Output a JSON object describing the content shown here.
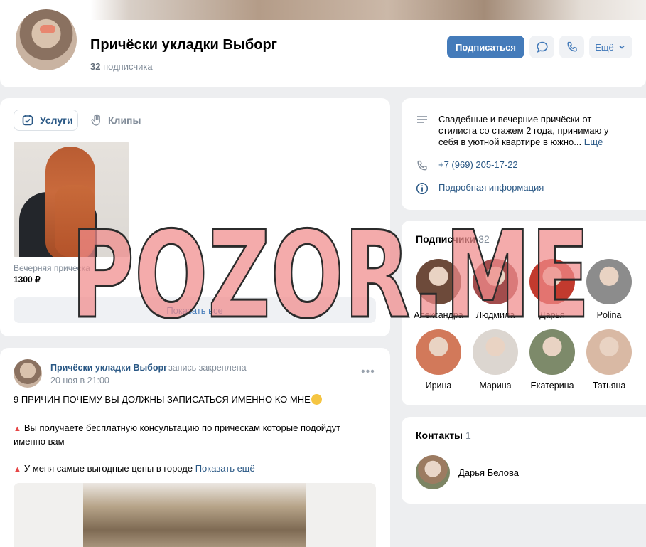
{
  "header": {
    "group_name": "Причёски укладки Выборг",
    "subscribers_count": "32",
    "subscribers_label": "подписчика",
    "subscribe_label": "Подписаться",
    "more_label": "Ещё",
    "icons": [
      "message-icon",
      "phone-icon",
      "chevron-down-icon"
    ]
  },
  "services": {
    "tabs": [
      {
        "label": "Услуги",
        "icon": "calendar-check-icon",
        "active": true
      },
      {
        "label": "Клипы",
        "icon": "clips-icon",
        "active": false
      }
    ],
    "items": [
      {
        "name": "Вечерняя прическа",
        "price": "1300 ₽"
      }
    ],
    "show_all_label": "Показать все"
  },
  "post": {
    "author": "Причёски укладки Выборг",
    "pinned": "запись закреплена",
    "date": "20 ноя в 21:00",
    "line1": "9 ПРИЧИН ПОЧЕМУ ВЫ ДОЛЖНЫ ЗАПИСАТЬСЯ ИМЕННО КО МНЕ",
    "line2a": "Вы получаете бесплатную консультацию по прическам которые подойдут",
    "line2b": "именно вам",
    "line3": "У меня самые выгодные цены в городе",
    "show_more": "Показать ещё",
    "menu": "•••"
  },
  "info": {
    "description_lines": [
      "Свадебные и вечерние причёски от",
      "стилиста со стажем 2 года, принимаю у",
      "себя в уютной квартире в южно..."
    ],
    "description_more": "Ещё",
    "phone": "+7 (969) 205-17-22",
    "details": "Подробная информация",
    "icons": [
      "description-icon",
      "phone-icon",
      "info-icon"
    ]
  },
  "subscribers": {
    "title": "Подписчики",
    "count": "32",
    "people": [
      {
        "name": "Александра",
        "color": "#6d4a3a"
      },
      {
        "name": "Людмила",
        "color": "#a24c4c"
      },
      {
        "name": "Дарья",
        "color": "#c23a2e"
      },
      {
        "name": "Polina",
        "color": "#8c8c8c"
      },
      {
        "name": "Ирина",
        "color": "#d2795a"
      },
      {
        "name": "Марина",
        "color": "#dcd6d0"
      },
      {
        "name": "Екатерина",
        "color": "#7d8a6a"
      },
      {
        "name": "Татьяна",
        "color": "#d9b9a4"
      }
    ]
  },
  "contacts": {
    "title": "Контакты",
    "count": "1",
    "name": "Дарья Белова"
  },
  "watermark": {
    "text": "POZOR.ME",
    "color": "#f08a8a"
  }
}
